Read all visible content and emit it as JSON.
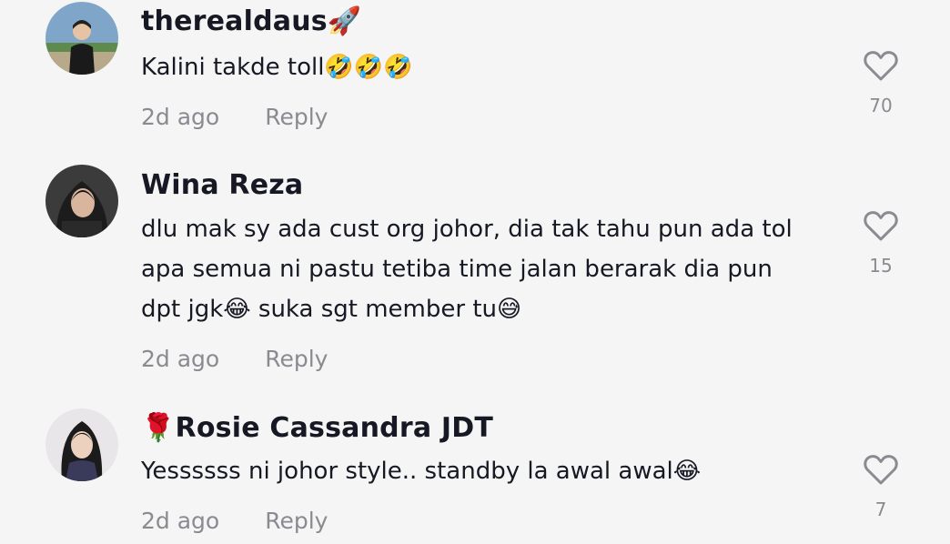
{
  "comments": [
    {
      "username": "therealdaus🚀",
      "text": "Kalini takde toll🤣🤣🤣",
      "time": "2d ago",
      "reply_label": "Reply",
      "likes": "70"
    },
    {
      "username": "Wina Reza",
      "text": "dlu mak sy ada cust org johor, dia tak tahu pun ada tol apa semua ni pastu tetiba time jalan berarak dia pun dpt jgk😂 suka sgt member tu😅",
      "time": "2d ago",
      "reply_label": "Reply",
      "likes": "15"
    },
    {
      "username": "🌹Rosie Cassandra JDT",
      "text": "Yessssss ni johor style.. standby la awal awal😂",
      "time": "2d ago",
      "reply_label": "Reply",
      "likes": "7"
    }
  ],
  "colors": {
    "background": "#f5f5f5",
    "text": "#161823",
    "muted": "#8a8b91"
  },
  "icons": [
    "heart-outline-icon",
    "user-avatar"
  ]
}
